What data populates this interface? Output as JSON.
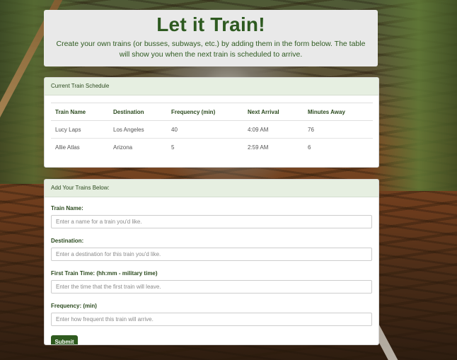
{
  "header": {
    "title": "Let it Train!",
    "subtitle": "Create your own trains (or busses, subways, etc.) by adding them in the form below. The table will show you when the next train is scheduled to arrive."
  },
  "schedule": {
    "heading": "Current Train Schedule",
    "columns": [
      "Train Name",
      "Destination",
      "Frequency (min)",
      "Next Arrival",
      "Minutes Away"
    ],
    "rows": [
      [
        "Lucy Laps",
        "Los Angeles",
        "40",
        "4:09 AM",
        "76"
      ],
      [
        "Allie Atlas",
        "Arizona",
        "5",
        "2:59 AM",
        "6"
      ]
    ]
  },
  "form": {
    "heading": "Add Your Trains Below:",
    "fields": [
      {
        "label": "Train Name:",
        "placeholder": "Enter a name for a train you'd like."
      },
      {
        "label": "Destination:",
        "placeholder": "Enter a destination for this train you'd like."
      },
      {
        "label": "First Train Time: (hh:mm - military time)",
        "placeholder": "Enter the time that the first train will leave."
      },
      {
        "label": "Frequency: (min)",
        "placeholder": "Enter how frequent this train will arrive."
      }
    ],
    "submit_label": "Submit"
  },
  "colors": {
    "accent_green": "#2e5a20",
    "button_green": "#2f5b1f",
    "header_bg": "#e6efe1"
  }
}
